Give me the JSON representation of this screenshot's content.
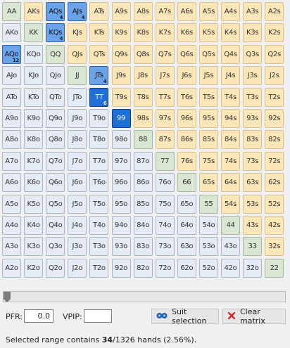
{
  "ranks": [
    "A",
    "K",
    "Q",
    "J",
    "T",
    "9",
    "8",
    "7",
    "6",
    "5",
    "4",
    "3",
    "2"
  ],
  "selected": {
    "AQs": {
      "level": "sel",
      "count": "4"
    },
    "AJs": {
      "level": "sel",
      "count": "4"
    },
    "KQs": {
      "level": "sel",
      "count": "4"
    },
    "AQo": {
      "level": "sel",
      "count": "12"
    },
    "JTs": {
      "level": "sel",
      "count": "4"
    },
    "TT": {
      "level": "sel-strong",
      "count": "6"
    },
    "99": {
      "level": "sel-strong",
      "count": ""
    }
  },
  "slider_position": 0,
  "controls": {
    "pfr_label": "PFR:",
    "pfr_value": "0.0",
    "vpip_label": "VPIP:",
    "vpip_value": "",
    "suit_selection_label": "Suit selection",
    "clear_matrix_label": "Clear matrix"
  },
  "status": {
    "prefix": "Selected range contains ",
    "selected_hands": "34",
    "total_hands": "/1326 hands (2.56%)."
  },
  "colors": {
    "pair": "#d9e6d2",
    "suited": "#fbe6b8",
    "offsuit": "#e4ebf4",
    "selected": "#6aa3e8",
    "selected_strong": "#1f6fd8"
  }
}
